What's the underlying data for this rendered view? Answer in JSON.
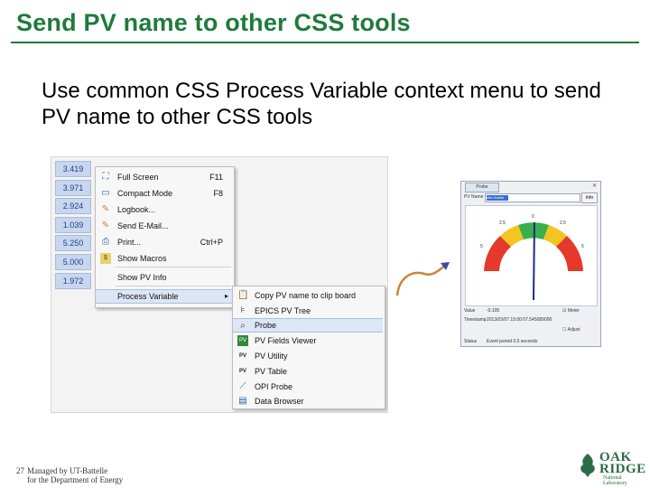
{
  "slide": {
    "title": "Send PV name to other CSS tools",
    "subtitle": "Use common CSS Process Variable context menu to send PV name to other CSS tools",
    "page_number": "27",
    "footer_line1": "Managed by UT-Battelle",
    "footer_line2": "for the Department of Energy",
    "logo_line1": "OAK",
    "logo_line2": "RIDGE",
    "logo_line3": "National Laboratory"
  },
  "pv_values": [
    "3.419",
    "3.971",
    "2.924",
    "1.039",
    "5.250",
    "5.000",
    "1.972"
  ],
  "context_menu": {
    "items": [
      {
        "label": "Full Screen",
        "shortcut": "F11",
        "icon": "fullscreen-icon"
      },
      {
        "label": "Compact Mode",
        "shortcut": "F8",
        "icon": "compact-mode-icon"
      },
      {
        "label": "Logbook...",
        "shortcut": "",
        "icon": "pencil-icon"
      },
      {
        "label": "Send E-Mail...",
        "shortcut": "",
        "icon": "pencil-icon"
      },
      {
        "label": "Print...",
        "shortcut": "Ctrl+P",
        "icon": "printer-icon"
      },
      {
        "label": "Show Macros",
        "shortcut": "",
        "icon": "macros-icon"
      },
      {
        "label": "Show PV Info",
        "shortcut": "",
        "icon": ""
      },
      {
        "label": "Process Variable",
        "shortcut": "",
        "icon": ""
      }
    ]
  },
  "submenu": {
    "items": [
      {
        "label": "Copy PV name to clip board",
        "icon": "clipboard-icon"
      },
      {
        "label": "EPICS PV Tree",
        "icon": "tree-icon"
      },
      {
        "label": "Probe",
        "icon": "magnifier-icon"
      },
      {
        "label": "PV Fields Viewer",
        "icon": "fields-viewer-icon"
      },
      {
        "label": "PV Utility",
        "icon": "pv-utility-icon"
      },
      {
        "label": "PV Table",
        "icon": "pv-table-icon"
      },
      {
        "label": "OPI Probe",
        "icon": "opi-probe-icon"
      },
      {
        "label": "Data Browser",
        "icon": "data-browser-icon"
      }
    ]
  },
  "probe_window": {
    "tab_label": "Probe",
    "pv_name_label": "PV Name",
    "pv_name_value": "sim://noise",
    "info_button": "Info",
    "tick_labels": [
      "0",
      "2.5",
      "2.5",
      "5",
      "5"
    ],
    "value_label": "Value",
    "value": "-0.105",
    "timestamp_label": "Timestamp",
    "timestamp": "2013/03/07 15:00:07.545089000",
    "show_meter_label": "Meter",
    "adjust_label": "Adjust",
    "status_label": "Status",
    "status": "Event period 0.5 seconds"
  }
}
